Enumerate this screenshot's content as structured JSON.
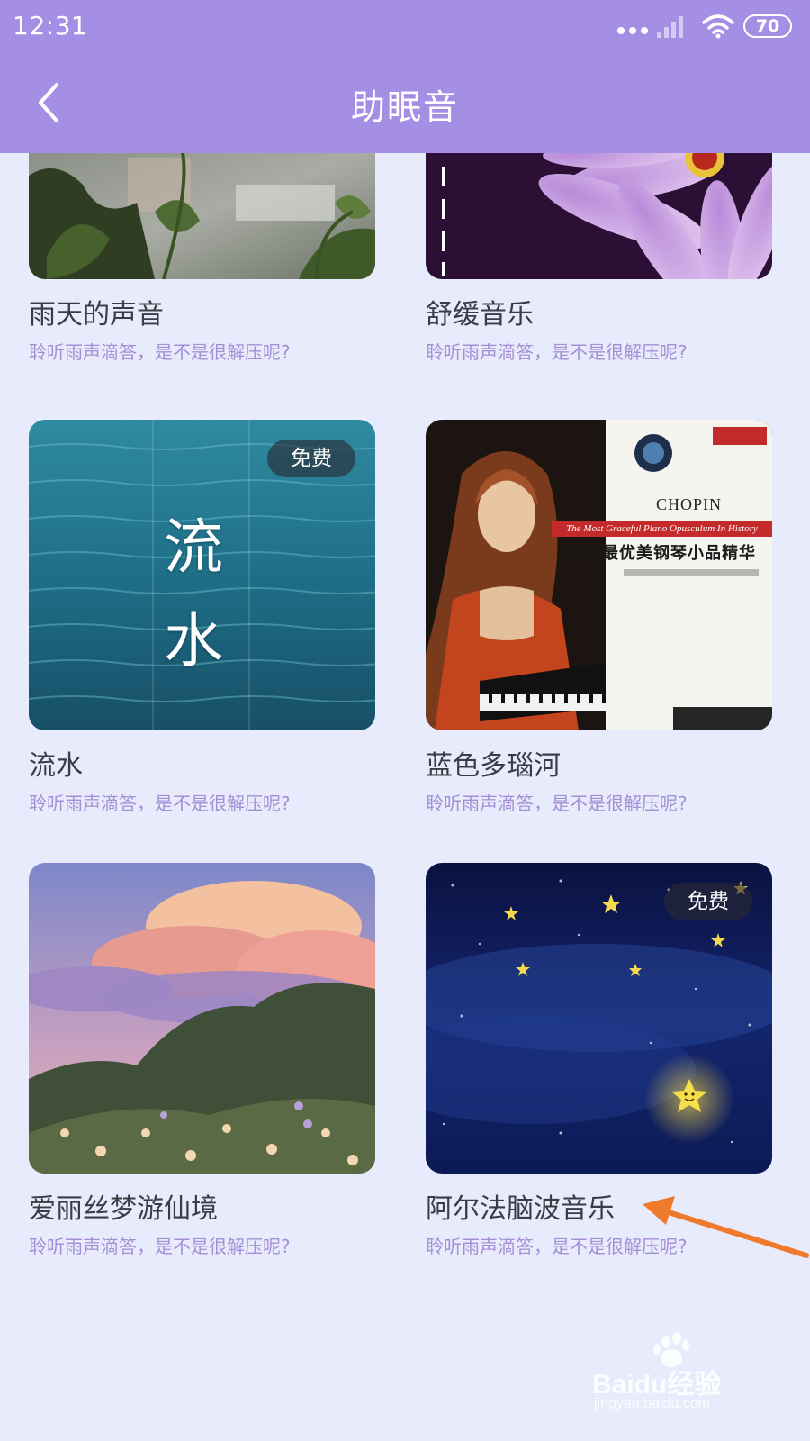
{
  "status_bar": {
    "time": "12:31",
    "battery": "70"
  },
  "header": {
    "title": "助眠音",
    "back_icon": "chevron-left-icon"
  },
  "cards": [
    {
      "title": "雨天的声音",
      "desc": "聆听雨声滴答，是不是很解压呢?",
      "badge": ""
    },
    {
      "title": "舒缓音乐",
      "desc": "聆听雨声滴答，是不是很解压呢?",
      "badge": ""
    },
    {
      "title": "流水",
      "desc": "聆听雨声滴答，是不是很解压呢?",
      "badge": "免费",
      "image_text": [
        "流",
        "水"
      ]
    },
    {
      "title": "蓝色多瑙河",
      "desc": "聆听雨声滴答，是不是很解压呢?",
      "badge": "",
      "image_text": {
        "chopin": "CHOPIN",
        "subtitle": "The Most Graceful Piano Opusculum In History",
        "cn": "史上最优美钢琴小品精华"
      }
    },
    {
      "title": "爱丽丝梦游仙境",
      "desc": "聆听雨声滴答，是不是很解压呢?",
      "badge": ""
    },
    {
      "title": "阿尔法脑波音乐",
      "desc": "聆听雨声滴答，是不是很解压呢?",
      "badge": "免费"
    }
  ],
  "watermark": {
    "brand": "Baidu经验",
    "url": "jingyan.baidu.com"
  },
  "colors": {
    "header": "#a58fe4",
    "background": "#e8ebfc",
    "desc_text": "#a48fd6",
    "arrow": "#f07a2c"
  }
}
